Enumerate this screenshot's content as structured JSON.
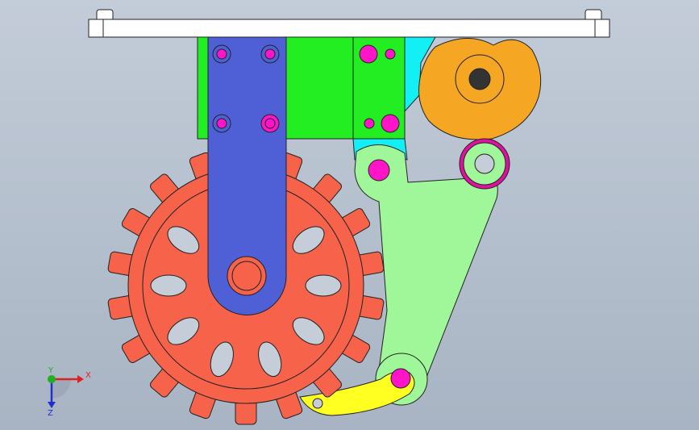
{
  "triad": {
    "x_label": "X",
    "y_label": "Y",
    "z_label": "Z",
    "x_color": "#e02020",
    "y_color": "#20b020",
    "z_color": "#2030d0"
  },
  "parts": {
    "top_plate": "#ffffff",
    "green_bracket": "#22ee22",
    "blue_link": "#4f60d6",
    "sprocket": "#f6624a",
    "cam": "#f5a623",
    "lever_arm": "#a0f79a",
    "cyan_block": "#12f0f5",
    "yellow_pawl": "#ffff22",
    "holes": "#ff14c8",
    "roller_ring": "#e010a0"
  }
}
